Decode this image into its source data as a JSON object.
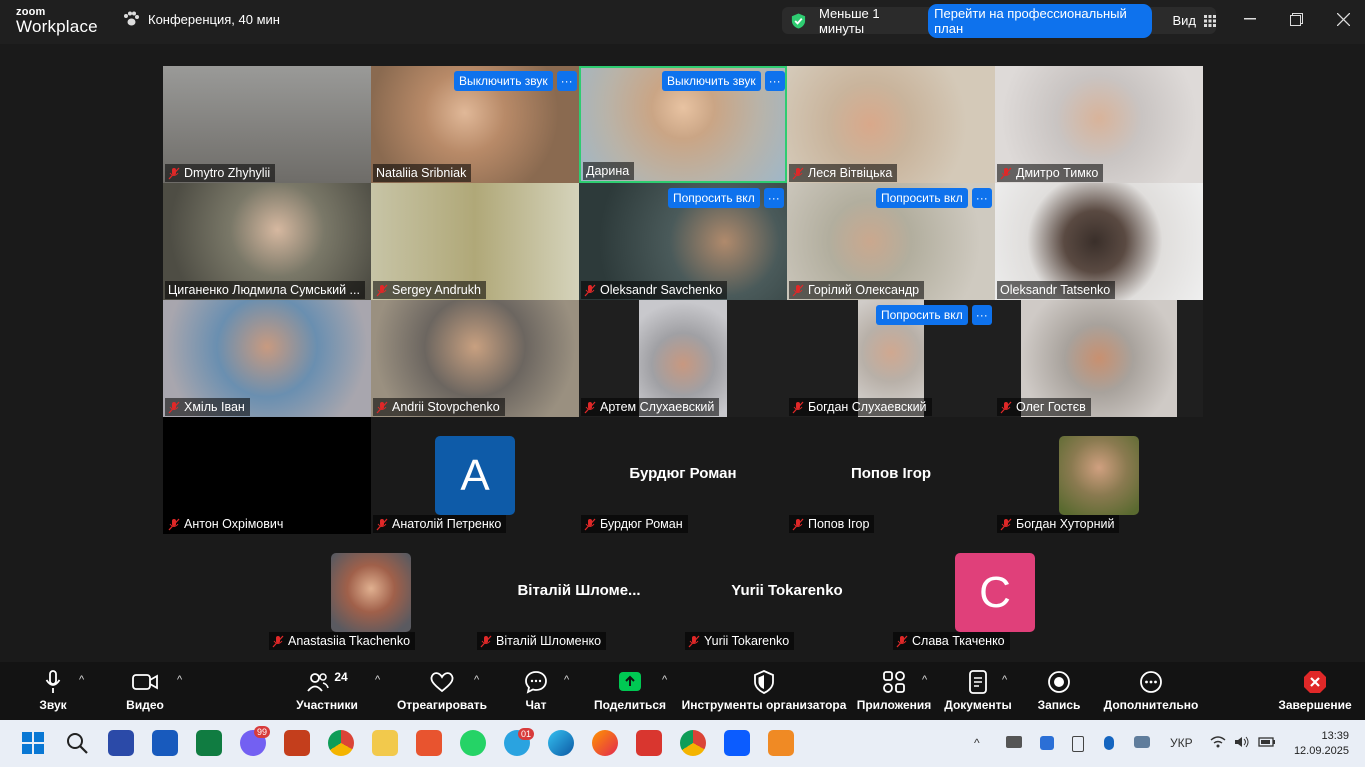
{
  "app": {
    "brand_small": "zoom",
    "brand_large": "Workplace",
    "meeting_title": "Конференция, 40 мин"
  },
  "header": {
    "timer_text": "Меньше 1 минуты",
    "upgrade_label": "Перейти на профессиональный план",
    "view_label": "Вид"
  },
  "overlay_labels": {
    "mute": "Выключить звук",
    "ask": "Попросить вкл",
    "dots": "···"
  },
  "participants": [
    {
      "name": "Dmytro Zhyhylii",
      "bg": "#8a8a88"
    },
    {
      "name": "Nataliia Sribniak",
      "bg": "#a07a5c"
    },
    {
      "name": "Дарина",
      "bg": "#c7b9a8"
    },
    {
      "name": "Леся Вітвіцька",
      "bg": "#c9b9a4"
    },
    {
      "name": "Дмитро Тимко",
      "bg": "#cfcac6"
    },
    {
      "name": "Циганенко Людмила Сумський ...",
      "bg": "#5e5f55"
    },
    {
      "name": "Sergey Andrukh",
      "bg": "#b6b397"
    },
    {
      "name": "Oleksandr Savchenko",
      "bg": "#3a4a4a"
    },
    {
      "name": "Горілий Олександр",
      "bg": "#b8b2a8"
    },
    {
      "name": "Oleksandr Tatsenko",
      "bg": "#d8d8d6"
    },
    {
      "name": "Хміль Іван",
      "bg": "#8e8c92"
    },
    {
      "name": "Andrii Stovpchenko",
      "bg": "#8c8478"
    },
    {
      "name": "Артем Слухаевский",
      "bg": "#8c8a88"
    },
    {
      "name": "Богдан Слухаевский",
      "bg": "#aaa49c"
    },
    {
      "name": "Олег Гостєв",
      "bg": "#b0a9a2"
    },
    {
      "name": "Антон Охрімович",
      "bg": "#000000"
    },
    {
      "name": "Анатолій Петренко",
      "avatar": "A",
      "avatar_color": "#0e5ba8"
    },
    {
      "name": "Бурдюг Роман",
      "big": "Бурдюг Роман"
    },
    {
      "name": "Попов Ігор",
      "big": "Попов Ігор"
    },
    {
      "name": "Богдан Хуторний"
    },
    {
      "name": "Anastasiia Tkachenko"
    },
    {
      "name": "Віталій Шломенко",
      "big": "Віталій  Шломе..."
    },
    {
      "name": "Yurii Tokarenko",
      "big": "Yurii Tokarenko"
    },
    {
      "name": "Слава Ткаченко",
      "avatar": "C",
      "avatar_color": "#e0407a"
    }
  ],
  "toolbar": {
    "audio": "Звук",
    "video": "Видео",
    "participants": "Участники",
    "participants_count": "24",
    "react": "Отреагировать",
    "chat": "Чат",
    "share": "Поделиться",
    "host_tools": "Инструменты организатора",
    "apps": "Приложения",
    "docs": "Документы",
    "record": "Запись",
    "more": "Дополнительно",
    "end": "Завершение"
  },
  "taskbar": {
    "lang": "УКР",
    "time": "13:39",
    "date": "12.09.2025",
    "viber_badge": "99",
    "telegram_badge": "01"
  },
  "colors": {
    "accent": "#0e72ed",
    "active_speaker": "#2ecc71",
    "muted": "#e02828",
    "share": "#00c853",
    "end": "#e02828"
  }
}
